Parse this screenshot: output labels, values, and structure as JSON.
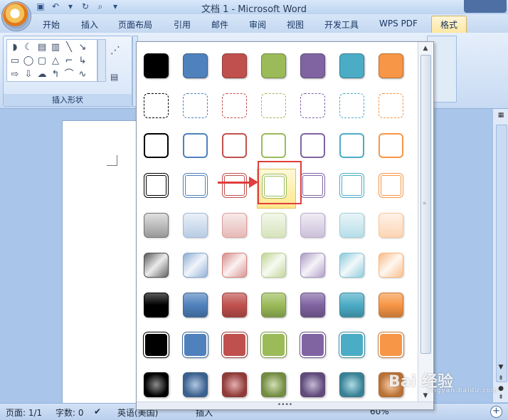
{
  "window": {
    "title": "文档 1 - Microsoft Word"
  },
  "tabs": [
    {
      "label": "开始"
    },
    {
      "label": "插入"
    },
    {
      "label": "页面布局"
    },
    {
      "label": "引用"
    },
    {
      "label": "邮件"
    },
    {
      "label": "审阅"
    },
    {
      "label": "视图"
    },
    {
      "label": "开发工具"
    },
    {
      "label": "WPS PDF"
    },
    {
      "label": "格式"
    }
  ],
  "ribbon": {
    "insert_shapes_group_label": "插入形状"
  },
  "status": {
    "page": "页面: 1/1",
    "words": "字数: 0",
    "language": "英语(美国)",
    "insert_mode": "插入",
    "zoom": "60%"
  },
  "watermark": {
    "text": "Bai 经验",
    "sub": "jingyan.baidu.com"
  },
  "shape_style_gallery": {
    "colors": [
      "#000000",
      "#4f81bd",
      "#c0504d",
      "#9bbb59",
      "#8064a2",
      "#4bacc6",
      "#f79646"
    ],
    "rows": [
      "solid-fill",
      "dashed-outline",
      "outline",
      "double-outline",
      "light-gradient",
      "moderate-gradient",
      "intense-gradient",
      "solid-white-border",
      "glow"
    ],
    "selected": {
      "row": 3,
      "column": 3
    }
  }
}
